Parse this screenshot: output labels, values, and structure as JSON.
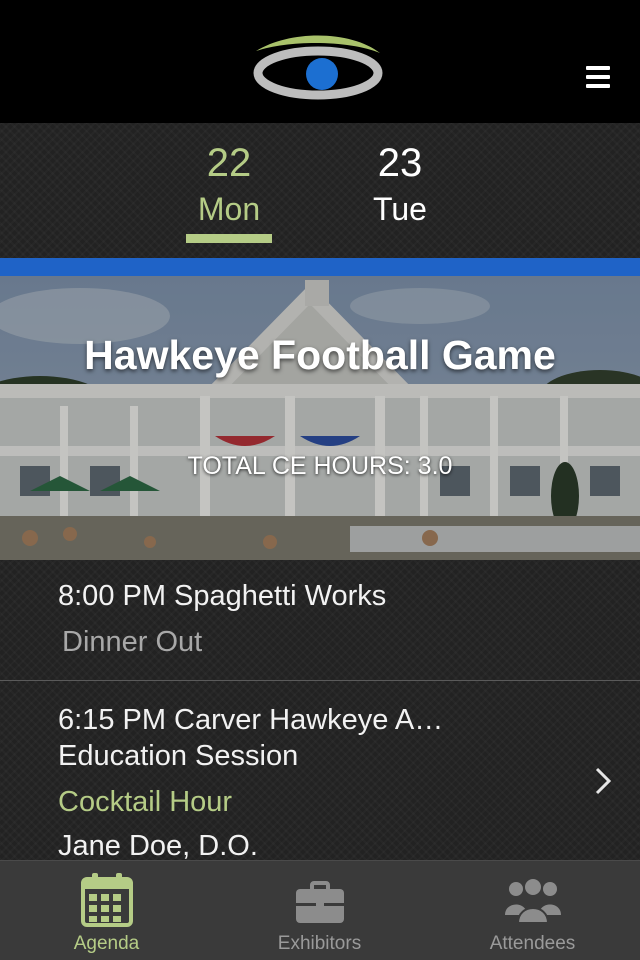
{
  "header": {
    "logo_icon": "eye-logo-icon",
    "menu_icon": "hamburger-menu-icon"
  },
  "day_tabs": [
    {
      "day": "22",
      "weekday": "Mon",
      "selected": true
    },
    {
      "day": "23",
      "weekday": "Tue",
      "selected": false
    }
  ],
  "colors": {
    "accent_green": "#b5cc86",
    "accent_blue": "#1f63c7",
    "header_bg": "#000000"
  },
  "hero": {
    "title": "Hawkeye Football Game",
    "ce_hours": "TOTAL CE HOURS: 3.0"
  },
  "agenda_items": [
    {
      "time_title": "8:00 PM Spaghetti Works",
      "category": "Dinner Out"
    },
    {
      "time_title": "6:15 PM Carver Hawkeye A…",
      "subtitle": "Education Session",
      "category": "Cocktail Hour",
      "speaker": "Jane Doe, D.O.",
      "chevron_icon": "chevron-right-icon"
    }
  ],
  "bottom_nav": [
    {
      "label": "Agenda",
      "icon": "calendar-icon",
      "active": true
    },
    {
      "label": "Exhibitors",
      "icon": "briefcase-icon",
      "active": false
    },
    {
      "label": "Attendees",
      "icon": "people-group-icon",
      "active": false
    }
  ]
}
